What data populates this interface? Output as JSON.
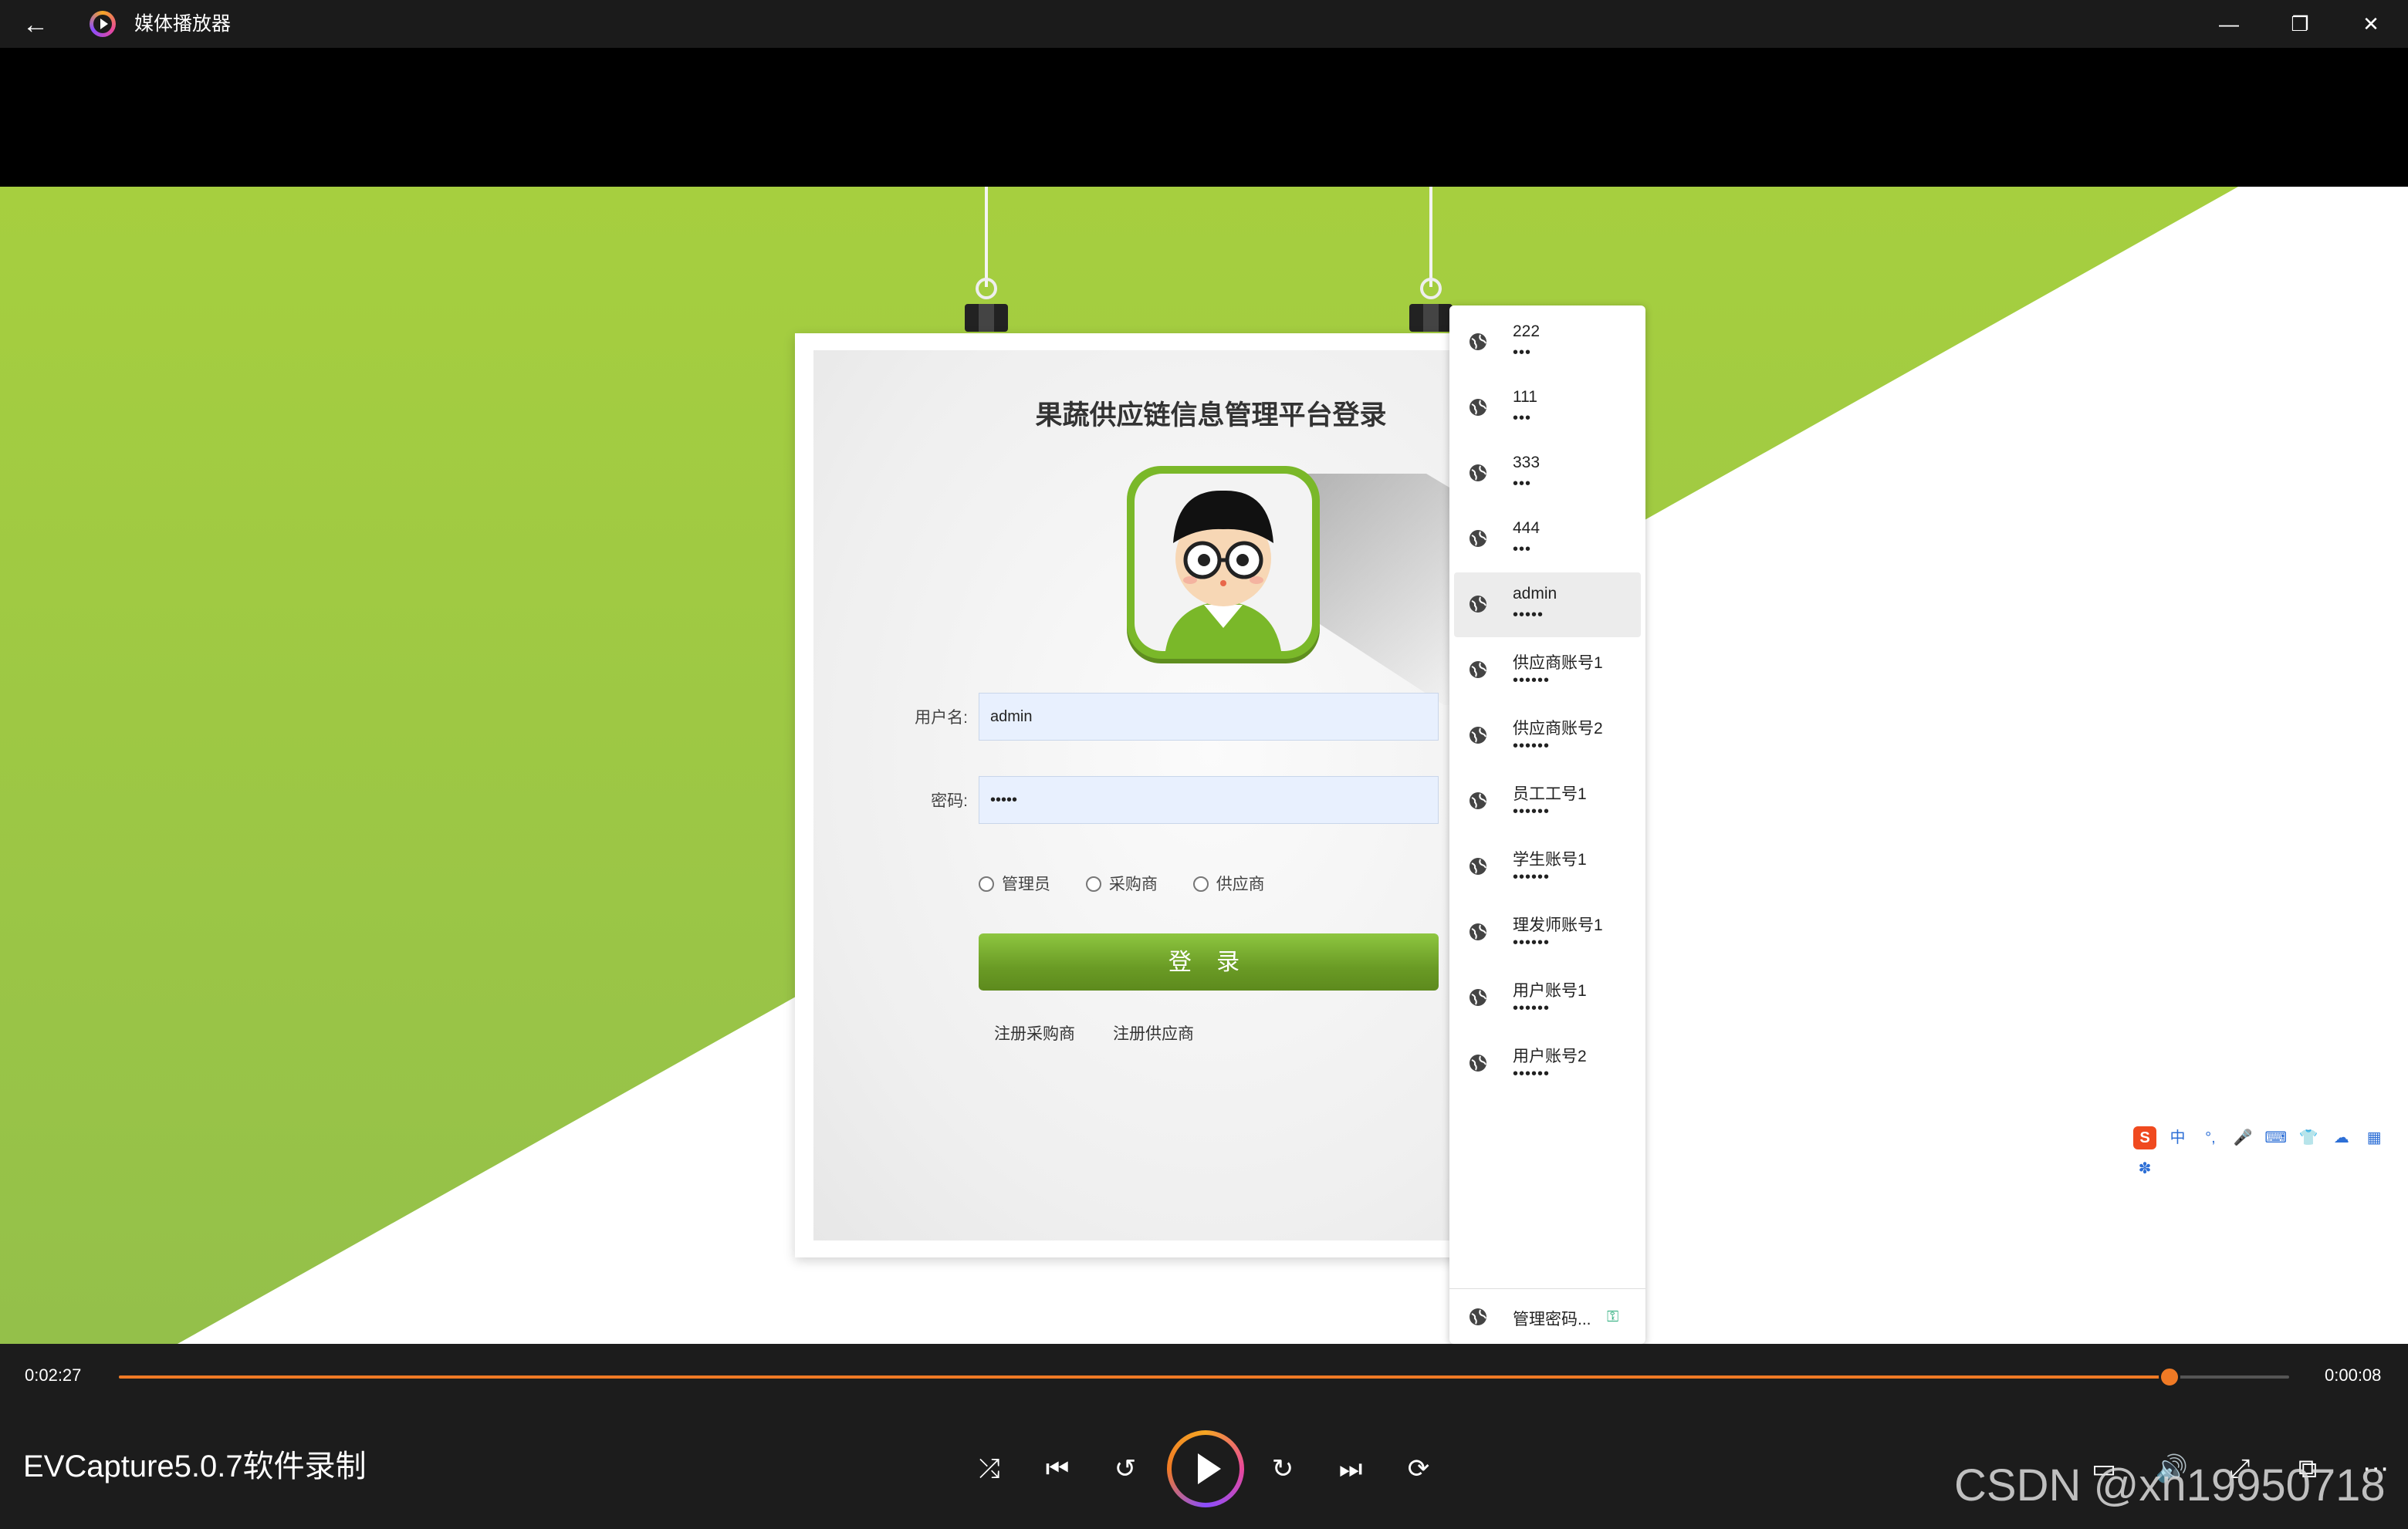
{
  "window": {
    "title": "媒体播放器",
    "back_icon": "←",
    "minimize_icon": "—",
    "restore_icon": "❐",
    "close_icon": "✕"
  },
  "login": {
    "title": "果蔬供应链信息管理平台登录",
    "username_label": "用户名:",
    "username_value": "admin",
    "password_label": "密码:",
    "password_value": "•••••",
    "roles": [
      "管理员",
      "采购商",
      "供应商"
    ],
    "login_button": "登 录",
    "register_buyer": "注册采购商",
    "register_supplier": "注册供应商"
  },
  "autofill": {
    "items": [
      {
        "user": "222",
        "pass": "•••"
      },
      {
        "user": "111",
        "pass": "•••"
      },
      {
        "user": "333",
        "pass": "•••"
      },
      {
        "user": "444",
        "pass": "•••"
      },
      {
        "user": "admin",
        "pass": "•••••"
      },
      {
        "user": "供应商账号1",
        "pass": "••••••"
      },
      {
        "user": "供应商账号2",
        "pass": "••••••"
      },
      {
        "user": "员工工号1",
        "pass": "••••••"
      },
      {
        "user": "学生账号1",
        "pass": "••••••"
      },
      {
        "user": "理发师账号1",
        "pass": "••••••"
      },
      {
        "user": "用户账号1",
        "pass": "••••••"
      },
      {
        "user": "用户账号2",
        "pass": "••••••"
      }
    ],
    "hovered_index": 4,
    "manage_label": "管理密码...",
    "key_icon": "⚿"
  },
  "ime": {
    "logo": "S",
    "mode": "中",
    "icons": [
      "°,",
      "🎤",
      "⌨",
      "👕",
      "☁",
      "▦",
      "✽"
    ]
  },
  "player": {
    "current_time": "0:02:27",
    "remaining_time": "0:00:08",
    "progress": 0.945,
    "media_title": "EVCapture5.0.7软件录制",
    "icons": {
      "shuffle": "⤮",
      "previous": "⏮",
      "rewind10": "↺",
      "forward30": "↻",
      "next": "⏭",
      "repeat": "⟳",
      "subtitles": "▭",
      "volume": "🔊",
      "fullscreen": "⤢",
      "miniplayer": "⧉",
      "more": "⋯"
    }
  },
  "watermark": "CSDN @xn19950718",
  "colors": {
    "accent_orange": "#f07a25",
    "green": "#8dc63f",
    "login_button": "#6a9b25"
  }
}
